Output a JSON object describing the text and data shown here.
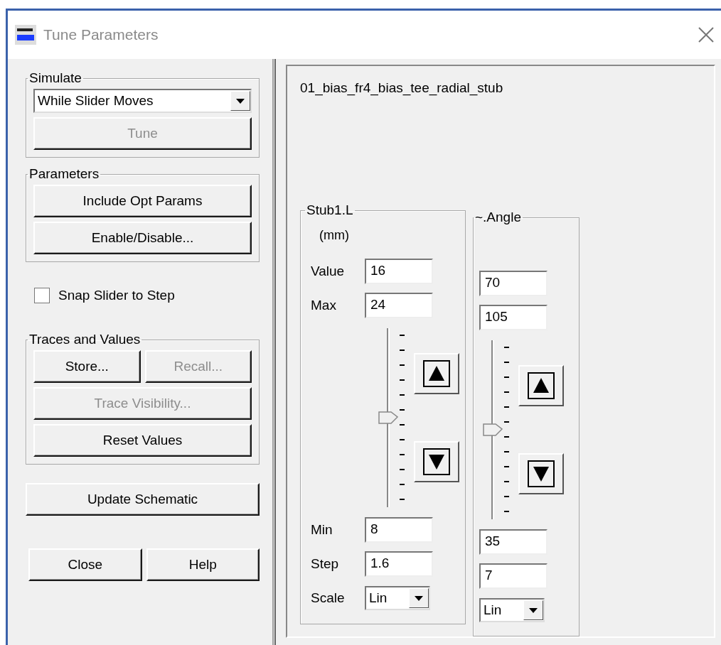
{
  "window": {
    "title": "Tune Parameters"
  },
  "simulate": {
    "title": "Simulate",
    "mode": "While Slider Moves",
    "tune": {
      "label": "Tune",
      "disabled": true
    }
  },
  "parameters": {
    "title": "Parameters",
    "buttons": [
      {
        "label": "Include Opt Params",
        "disabled": false
      },
      {
        "label": "Enable/Disable...",
        "disabled": false
      }
    ]
  },
  "snap": {
    "label": "Snap Slider to Step",
    "checked": false
  },
  "traces": {
    "title": "Traces and Values",
    "row": [
      {
        "label": "Store...",
        "disabled": false
      },
      {
        "label": "Recall...",
        "disabled": true
      }
    ],
    "buttons": [
      {
        "label": "Trace Visibility...",
        "disabled": true
      },
      {
        "label": "Reset Values",
        "disabled": false
      }
    ]
  },
  "update": {
    "label": "Update Schematic"
  },
  "footer": [
    {
      "label": "Close"
    },
    {
      "label": "Help"
    }
  ],
  "design": {
    "name": "01_bias_fr4_bias_tee_radial_stub"
  },
  "params": [
    {
      "name": "Stub1.L",
      "unit": "(mm)",
      "top_fields": [
        {
          "label": "Value",
          "value": "16"
        },
        {
          "label": "Max",
          "value": "24"
        }
      ],
      "level": 0.5,
      "bottom_fields": [
        {
          "label": "Min",
          "value": "8"
        },
        {
          "label": "Step",
          "value": "1.6"
        }
      ],
      "scale": {
        "label": "Scale",
        "value": "Lin"
      }
    },
    {
      "name": "~.Angle",
      "top_fields": [
        {
          "value": "70"
        },
        {
          "value": "105"
        }
      ],
      "level": 0.5,
      "bottom_fields": [
        {
          "value": "35"
        },
        {
          "value": "7"
        }
      ],
      "scale": {
        "value": "Lin"
      }
    }
  ]
}
